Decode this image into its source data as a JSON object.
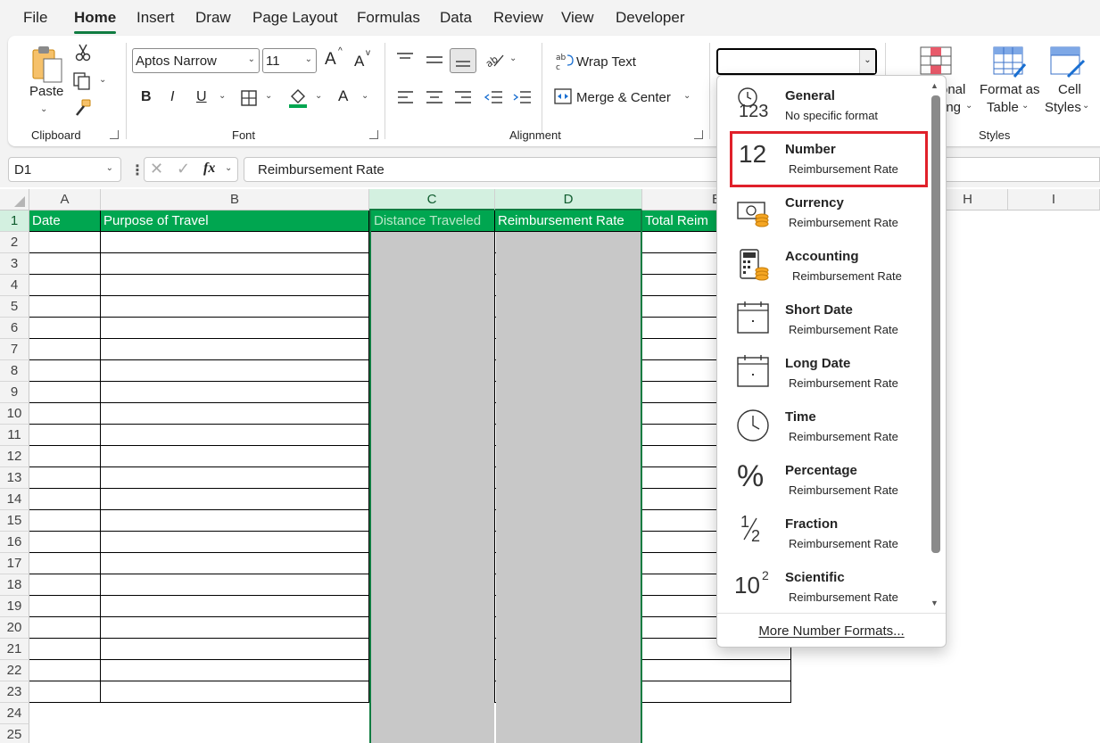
{
  "menu": {
    "tabs": [
      "File",
      "Home",
      "Insert",
      "Draw",
      "Page Layout",
      "Formulas",
      "Data",
      "Review",
      "View",
      "Developer"
    ],
    "active_tab": "Home"
  },
  "ribbon": {
    "clipboard": {
      "paste_label": "Paste",
      "group_label": "Clipboard"
    },
    "font": {
      "font_name": "Aptos Narrow",
      "font_size": "11",
      "grow_glyph": "A",
      "shrink_glyph": "A",
      "bold": "B",
      "italic": "I",
      "underline": "U",
      "font_color_glyph": "A",
      "group_label": "Font"
    },
    "alignment": {
      "wrap_text_label": "Wrap Text",
      "merge_center_label": "Merge & Center",
      "group_label": "Alignment"
    },
    "number": {
      "format_value": ""
    },
    "styles": {
      "conditional_label_1": "onal",
      "conditional_label_2": "ing",
      "format_table_label_1": "Format as",
      "format_table_label_2": "Table",
      "cell_styles_label_1": "Cell",
      "cell_styles_label_2": "Styles",
      "group_label": "Styles"
    }
  },
  "formula_bar": {
    "name_box": "D1",
    "fx_label": "fx",
    "formula": "Reimbursement Rate"
  },
  "grid": {
    "columns": [
      "A",
      "B",
      "C",
      "D",
      "E",
      "H",
      "I"
    ],
    "rows": [
      "1",
      "2",
      "3",
      "4",
      "5",
      "6",
      "7",
      "8",
      "9",
      "10",
      "11",
      "12",
      "13",
      "14",
      "15",
      "16",
      "17",
      "18",
      "19",
      "20",
      "21",
      "22",
      "23",
      "24",
      "25"
    ],
    "header_cells": [
      "Date",
      "Purpose of Travel",
      "Distance Traveled",
      "Reimbursement Rate",
      "Total Reim"
    ],
    "colors": {
      "header_green": "#00a650",
      "selection_green": "#107c41",
      "shaded": "#c8c8c8",
      "highlight_red": "#e0202a"
    }
  },
  "dropdown": {
    "items": [
      {
        "name": "General",
        "sub": "No specific format",
        "icon": "general-clock-123-icon"
      },
      {
        "name": "Number",
        "sub": "Reimbursement Rate",
        "icon": "number-12-icon"
      },
      {
        "name": "Currency",
        "sub": "Reimbursement Rate",
        "icon": "currency-bill-icon"
      },
      {
        "name": "Accounting",
        "sub": "Reimbursement Rate",
        "icon": "accounting-calculator-icon"
      },
      {
        "name": "Short Date",
        "sub": "Reimbursement Rate",
        "icon": "short-date-calendar-icon"
      },
      {
        "name": "Long Date",
        "sub": "Reimbursement Rate",
        "icon": "long-date-calendar-icon"
      },
      {
        "name": "Time",
        "sub": "Reimbursement Rate",
        "icon": "time-clock-icon"
      },
      {
        "name": "Percentage",
        "sub": "Reimbursement Rate",
        "icon": "percent-icon"
      },
      {
        "name": "Fraction",
        "sub": "Reimbursement Rate",
        "icon": "fraction-icon"
      },
      {
        "name": "Scientific",
        "sub": "Reimbursement Rate",
        "icon": "scientific-icon"
      }
    ],
    "number_glyph": "12",
    "general_glyph": "123",
    "percent_glyph": "%",
    "fraction_num": "1",
    "fraction_den": "2",
    "sci_base": "10",
    "sci_exp": "2",
    "more_label": "More Number Formats...",
    "highlighted": "Number"
  }
}
